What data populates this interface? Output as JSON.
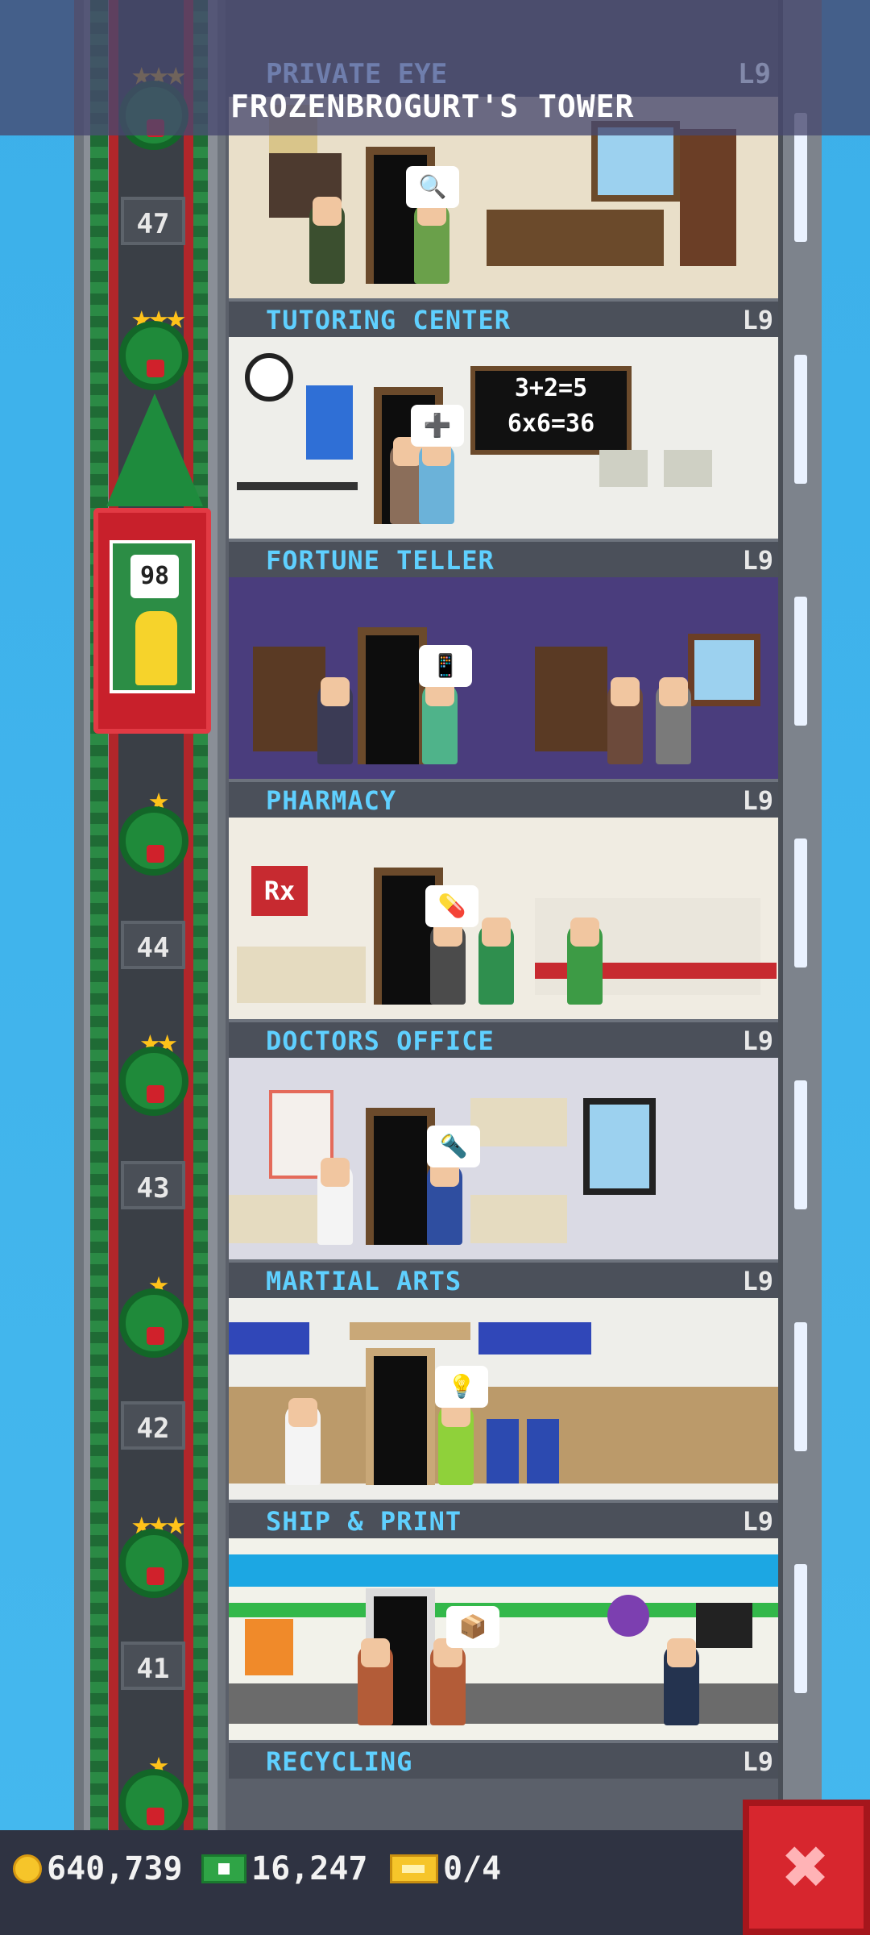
{
  "header": {
    "prev_floor_name": "PRIVATE EYE",
    "prev_floor_level": "L9",
    "tower_title": "FROZENBROGURT'S TOWER"
  },
  "elevator": {
    "passenger_floor": "98"
  },
  "shaft_floors": [
    "47",
    "44",
    "43",
    "42",
    "41"
  ],
  "rooms": [
    {
      "name": "TUTORING CENTER",
      "level": "L9",
      "bubble": "🔍"
    },
    {
      "name": "FORTUNE TELLER",
      "level": "L9",
      "bubble": "➕",
      "chalkboard": [
        "3+2=5",
        "6x6=36"
      ]
    },
    {
      "name": "PHARMACY",
      "level": "L9",
      "bubble": "📱"
    },
    {
      "name": "DOCTORS OFFICE",
      "level": "L9",
      "bubble": "💊",
      "rx_sign": "Rx"
    },
    {
      "name": "MARTIAL ARTS",
      "level": "L9",
      "bubble": "🔦"
    },
    {
      "name": "SHIP & PRINT",
      "level": "L9",
      "bubble": "💡"
    },
    {
      "name": "RECYCLING",
      "level": "L9",
      "bubble": "📦"
    }
  ],
  "status": {
    "coins": "640,739",
    "bux": "16,247",
    "tickets": "0/4"
  },
  "icons": {
    "coin": "coin-icon",
    "bux": "tower-bux-icon",
    "ticket": "golden-ticket-icon",
    "close": "close-icon"
  },
  "colors": {
    "label_text": "#5fd0ff",
    "close_button": "#d7262e",
    "sky": "#3cb0ea"
  }
}
